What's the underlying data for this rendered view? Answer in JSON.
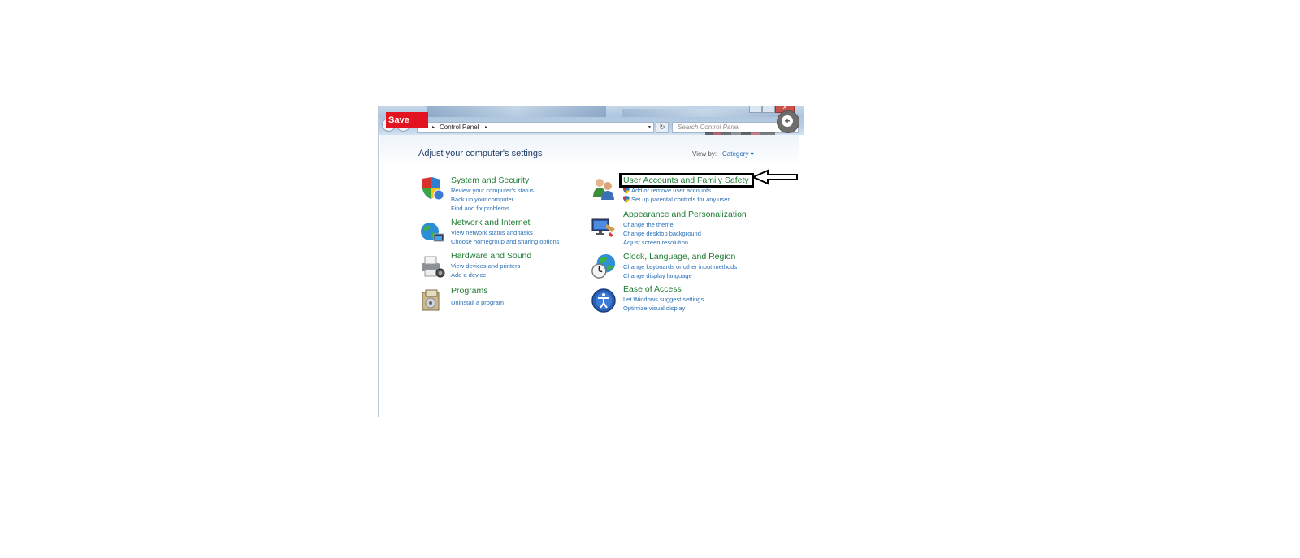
{
  "overlay": {
    "save_label": "Save",
    "help_icon": "plus-circle-icon",
    "annotation_arrow_icon": "arrow-left-outline-icon"
  },
  "window": {
    "title_bar_buttons": [
      "minimize-icon",
      "maximize-icon",
      "close-icon"
    ],
    "close_glyph": "x"
  },
  "address_bar": {
    "breadcrumb": "Control Panel",
    "separator_glyph": "▸",
    "dropdown_glyph": "▾",
    "refresh_glyph": "↻"
  },
  "search": {
    "placeholder": "Search Control Panel"
  },
  "header": {
    "title": "Adjust your computer's settings",
    "view_by_label": "View by:",
    "view_by_value": "Category ▾"
  },
  "categories": {
    "system": {
      "title": "System and Security",
      "links": [
        "Review your computer's status",
        "Back up your computer",
        "Find and fix problems"
      ]
    },
    "network": {
      "title": "Network and Internet",
      "links": [
        "View network status and tasks",
        "Choose homegroup and sharing options"
      ]
    },
    "hardware": {
      "title": "Hardware and Sound",
      "links": [
        "View devices and printers",
        "Add a device"
      ]
    },
    "programs": {
      "title": "Programs",
      "links": [
        "Uninstall a program"
      ]
    },
    "user_accounts": {
      "title": "User Accounts and Family Safety",
      "links": [
        "Add or remove user accounts",
        "Set up parental controls for any user"
      ]
    },
    "appearance": {
      "title": "Appearance and Personalization",
      "links": [
        "Change the theme",
        "Change desktop background",
        "Adjust screen resolution"
      ]
    },
    "clock": {
      "title": "Clock, Language, and Region",
      "links": [
        "Change keyboards or other input methods",
        "Change display language"
      ]
    },
    "ease": {
      "title": "Ease of Access",
      "links": [
        "Let Windows suggest settings",
        "Optimize visual display"
      ]
    }
  },
  "colors": {
    "category_title": "#1e7a32",
    "link": "#2a6fb5",
    "save_button": "#e3141f",
    "annotation": "#000000"
  }
}
